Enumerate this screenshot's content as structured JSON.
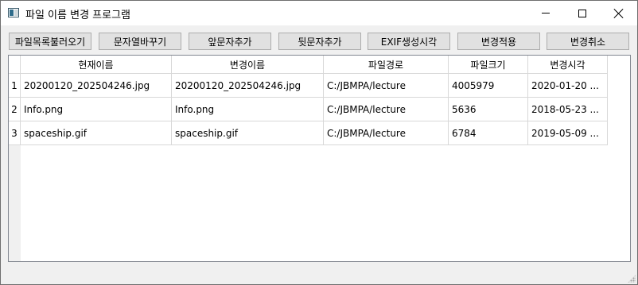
{
  "window": {
    "title": "파일 이름 변경 프로그램"
  },
  "toolbar": {
    "buttons": [
      {
        "label": "파일목록불러오기"
      },
      {
        "label": "문자열바꾸기"
      },
      {
        "label": "앞문자추가"
      },
      {
        "label": "뒷문자추가"
      },
      {
        "label": "EXIF생성시각"
      },
      {
        "label": "변경적용"
      },
      {
        "label": "변경취소"
      }
    ]
  },
  "table": {
    "columns": [
      "현재이름",
      "변경이름",
      "파일경로",
      "파일크기",
      "변경시각"
    ],
    "rows": [
      {
        "num": "1",
        "cells": [
          "20200120_202504246.jpg",
          "20200120_202504246.jpg",
          "C:/JBMPA/lecture",
          "4005979",
          "2020-01-20 ..."
        ]
      },
      {
        "num": "2",
        "cells": [
          "Info.png",
          "Info.png",
          "C:/JBMPA/lecture",
          "5636",
          "2018-05-23 ..."
        ]
      },
      {
        "num": "3",
        "cells": [
          "spaceship.gif",
          "spaceship.gif",
          "C:/JBMPA/lecture",
          "6784",
          "2019-05-09 ..."
        ]
      }
    ]
  }
}
